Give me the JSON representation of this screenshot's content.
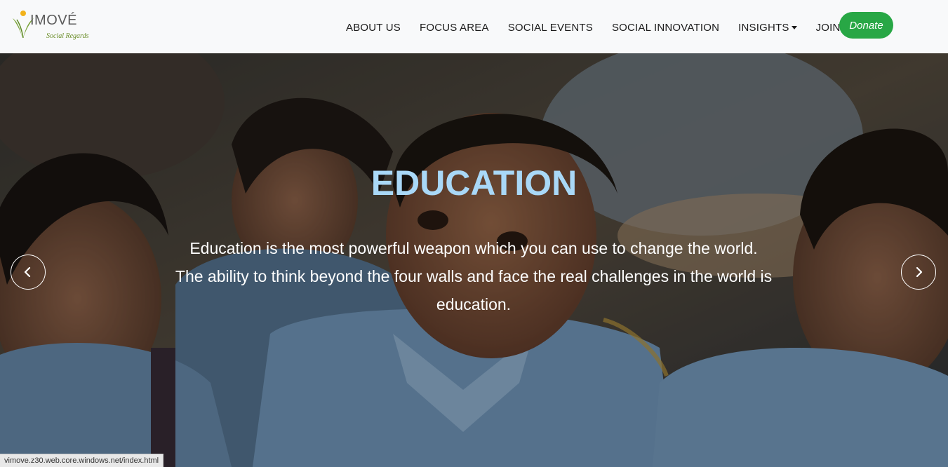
{
  "brand": {
    "name": "IMOVÉ",
    "tagline": "Social Regards",
    "logo_icon": "vimove-leaf-logo"
  },
  "nav": {
    "items": [
      {
        "label": "ABOUT US",
        "dropdown": false
      },
      {
        "label": "FOCUS AREA",
        "dropdown": false
      },
      {
        "label": "SOCIAL EVENTS",
        "dropdown": false
      },
      {
        "label": "SOCIAL INNOVATION",
        "dropdown": false
      },
      {
        "label": "INSIGHTS",
        "dropdown": true
      },
      {
        "label": "JOIN US",
        "dropdown": true
      }
    ],
    "donate_label": "Donate"
  },
  "hero": {
    "title": "EDUCATION",
    "lines": [
      "Education is the most powerful weapon which you can use to change the world.",
      "The ability to think beyond the four walls and face the real challenges in the world is",
      "education."
    ],
    "prev_icon": "chevron-left-icon",
    "next_icon": "chevron-right-icon"
  },
  "status_bar": {
    "url": "vimove.z30.web.core.windows.net/index.html"
  },
  "colors": {
    "navbar_bg": "#f8f9fa",
    "donate_bg": "#28a745",
    "title_color": "#a9d8f7",
    "logo_green": "#7aa33a",
    "logo_yellow": "#f2b21b"
  }
}
